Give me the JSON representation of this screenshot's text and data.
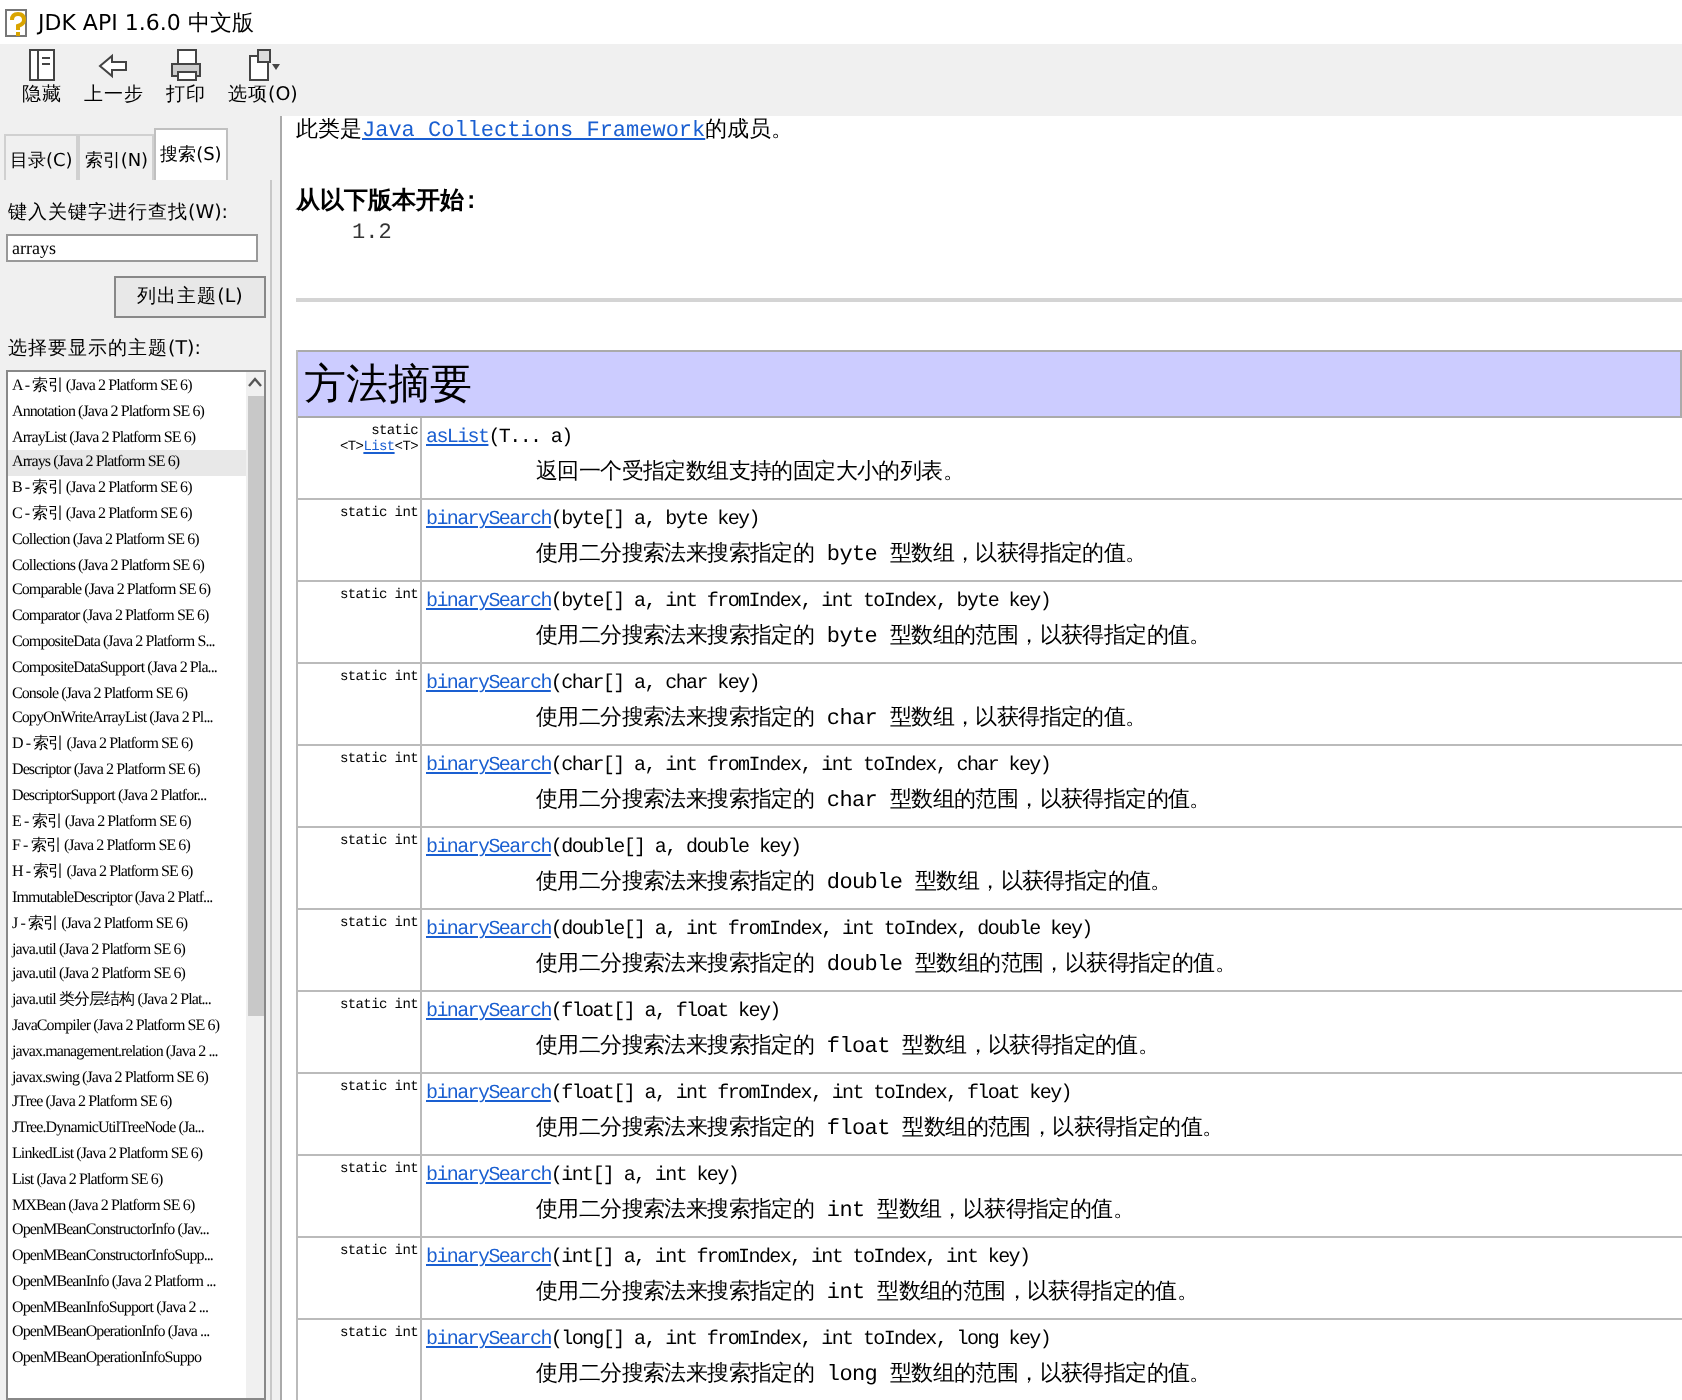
{
  "window": {
    "title": "JDK API 1.6.0 中文版"
  },
  "toolbar": [
    {
      "kind": "hide",
      "label": "隐藏"
    },
    {
      "kind": "back",
      "label": "上一步"
    },
    {
      "kind": "print",
      "label": "打印"
    },
    {
      "kind": "options",
      "label": "选项(O)"
    }
  ],
  "sidebar": {
    "tabs": [
      {
        "label": "目录(C)",
        "selected": false
      },
      {
        "label": "索引(N)",
        "selected": false
      },
      {
        "label": "搜索(S)",
        "selected": true
      }
    ],
    "search_label": "键入关键字进行查找(W):",
    "search_value": "arrays",
    "list_button": "列出主题(L)",
    "topics_label": "选择要显示的主题(T):",
    "topics": [
      {
        "label": "A - 索引 (Java 2 Platform SE 6)",
        "selected": false
      },
      {
        "label": "Annotation (Java 2 Platform SE 6)",
        "selected": false
      },
      {
        "label": "ArrayList (Java 2 Platform SE 6)",
        "selected": false
      },
      {
        "label": "Arrays (Java 2 Platform SE 6)",
        "selected": true
      },
      {
        "label": "B - 索引 (Java 2 Platform SE 6)",
        "selected": false
      },
      {
        "label": "C - 索引 (Java 2 Platform SE 6)",
        "selected": false
      },
      {
        "label": "Collection (Java 2 Platform SE 6)",
        "selected": false
      },
      {
        "label": "Collections (Java 2 Platform SE 6)",
        "selected": false
      },
      {
        "label": "Comparable (Java 2 Platform SE 6)",
        "selected": false
      },
      {
        "label": "Comparator (Java 2 Platform SE 6)",
        "selected": false
      },
      {
        "label": "CompositeData (Java 2 Platform S...",
        "selected": false
      },
      {
        "label": "CompositeDataSupport (Java 2 Pla...",
        "selected": false
      },
      {
        "label": "Console (Java 2 Platform SE 6)",
        "selected": false
      },
      {
        "label": "CopyOnWriteArrayList (Java 2 Pl...",
        "selected": false
      },
      {
        "label": "D - 索引 (Java 2 Platform SE 6)",
        "selected": false
      },
      {
        "label": "Descriptor (Java 2 Platform SE 6)",
        "selected": false
      },
      {
        "label": "DescriptorSupport (Java 2 Platfor...",
        "selected": false
      },
      {
        "label": "E - 索引 (Java 2 Platform SE 6)",
        "selected": false
      },
      {
        "label": "F - 索引 (Java 2 Platform SE 6)",
        "selected": false
      },
      {
        "label": "H - 索引 (Java 2 Platform SE 6)",
        "selected": false
      },
      {
        "label": "ImmutableDescriptor (Java 2 Platf...",
        "selected": false
      },
      {
        "label": "J - 索引 (Java 2 Platform SE 6)",
        "selected": false
      },
      {
        "label": "java.util (Java 2 Platform SE 6)",
        "selected": false
      },
      {
        "label": "java.util (Java 2 Platform SE 6)",
        "selected": false
      },
      {
        "label": "java.util 类分层结构 (Java 2 Plat...",
        "selected": false
      },
      {
        "label": "JavaCompiler (Java 2 Platform SE 6)",
        "selected": false
      },
      {
        "label": "javax.management.relation (Java 2 ...",
        "selected": false
      },
      {
        "label": "javax.swing (Java 2 Platform SE 6)",
        "selected": false
      },
      {
        "label": "JTree (Java 2 Platform SE 6)",
        "selected": false
      },
      {
        "label": "JTree.DynamicUtilTreeNode (Ja...",
        "selected": false
      },
      {
        "label": "LinkedList (Java 2 Platform SE 6)",
        "selected": false
      },
      {
        "label": "List (Java 2 Platform SE 6)",
        "selected": false
      },
      {
        "label": "MXBean (Java 2 Platform SE 6)",
        "selected": false
      },
      {
        "label": "OpenMBeanConstructorInfo (Jav...",
        "selected": false
      },
      {
        "label": "OpenMBeanConstructorInfoSupp...",
        "selected": false
      },
      {
        "label": "OpenMBeanInfo (Java 2 Platform ...",
        "selected": false
      },
      {
        "label": "OpenMBeanInfoSupport (Java 2 ...",
        "selected": false
      },
      {
        "label": "OpenMBeanOperationInfo (Java ...",
        "selected": false
      },
      {
        "label": "OpenMBeanOperationInfoSuppo",
        "selected": false
      }
    ]
  },
  "content": {
    "intro_prefix": "此类是",
    "intro_link": "Java Collections Framework",
    "intro_suffix": "的成员。",
    "since_label": "从以下版本开始:",
    "since_value": "1.2",
    "section_title": "方法摘要",
    "methods": [
      {
        "modifier": "static",
        "return_prefix": "<T>",
        "return_link": "List",
        "return_suffix": "<T>",
        "name": "asList",
        "params": "(T... a)",
        "description": "返回一个受指定数组支持的固定大小的列表。"
      },
      {
        "modifier": "static int",
        "name": "binarySearch",
        "params": "(byte[] a, byte key)",
        "description": "使用二分搜索法来搜索指定的 byte 型数组，以获得指定的值。"
      },
      {
        "modifier": "static int",
        "name": "binarySearch",
        "params": "(byte[] a, int fromIndex, int toIndex, byte key)",
        "description": "使用二分搜索法来搜索指定的 byte 型数组的范围，以获得指定的值。"
      },
      {
        "modifier": "static int",
        "name": "binarySearch",
        "params": "(char[] a, char key)",
        "description": "使用二分搜索法来搜索指定的 char 型数组，以获得指定的值。"
      },
      {
        "modifier": "static int",
        "name": "binarySearch",
        "params": "(char[] a, int fromIndex, int toIndex, char key)",
        "description": "使用二分搜索法来搜索指定的 char 型数组的范围，以获得指定的值。"
      },
      {
        "modifier": "static int",
        "name": "binarySearch",
        "params": "(double[] a, double key)",
        "description": "使用二分搜索法来搜索指定的 double 型数组，以获得指定的值。"
      },
      {
        "modifier": "static int",
        "name": "binarySearch",
        "params": "(double[] a, int fromIndex, int toIndex, double key)",
        "description": "使用二分搜索法来搜索指定的 double 型数组的范围，以获得指定的值。"
      },
      {
        "modifier": "static int",
        "name": "binarySearch",
        "params": "(float[] a, float key)",
        "description": "使用二分搜索法来搜索指定的 float 型数组，以获得指定的值。"
      },
      {
        "modifier": "static int",
        "name": "binarySearch",
        "params": "(float[] a, int fromIndex, int toIndex, float key)",
        "description": "使用二分搜索法来搜索指定的 float 型数组的范围，以获得指定的值。"
      },
      {
        "modifier": "static int",
        "name": "binarySearch",
        "params": "(int[] a, int key)",
        "description": "使用二分搜索法来搜索指定的 int 型数组，以获得指定的值。"
      },
      {
        "modifier": "static int",
        "name": "binarySearch",
        "params": "(int[] a, int fromIndex, int toIndex, int key)",
        "description": "使用二分搜索法来搜索指定的 int 型数组的范围，以获得指定的值。"
      },
      {
        "modifier": "static int",
        "name": "binarySearch",
        "params": "(long[] a, int fromIndex, int toIndex, long key)",
        "description": "使用二分搜索法来搜索指定的 long 型数组的范围，以获得指定的值。"
      }
    ]
  }
}
